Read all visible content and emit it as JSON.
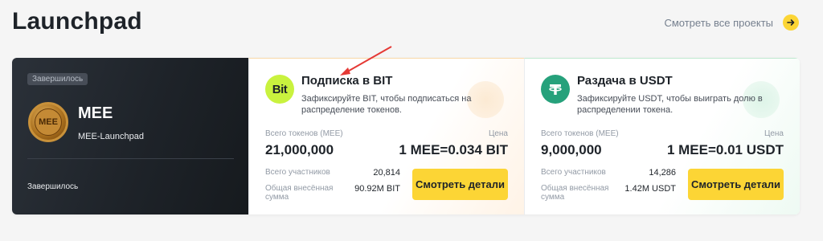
{
  "page": {
    "title": "Launchpad",
    "view_all": "Смотреть все проекты"
  },
  "project": {
    "status_badge": "Завершилось",
    "name": "MEE",
    "subtitle": "MEE-Launchpad",
    "coin_text": "MEE",
    "footer_status": "Завершилось"
  },
  "cards": [
    {
      "logo_text": "Bit",
      "title": "Подписка в BIT",
      "description": "Зафиксируйте BIT, чтобы подписаться на распределение токенов.",
      "tokens_label": "Всего токенов (MEE)",
      "tokens_value": "21,000,000",
      "price_label": "Цена",
      "price_value": "1 MEE=0.034 BIT",
      "participants_label": "Всего участников",
      "participants_value": "20,814",
      "deposit_label": "Общая внесённая сумма",
      "deposit_value": "90.92M BIT",
      "button": "Смотреть детали"
    },
    {
      "logo_text": "T",
      "title": "Раздача в USDT",
      "description": "Зафиксируйте USDT, чтобы выиграть долю в распределении токена.",
      "tokens_label": "Всего токенов (MEE)",
      "tokens_value": "9,000,000",
      "price_label": "Цена",
      "price_value": "1 MEE=0.01 USDT",
      "participants_label": "Всего участников",
      "participants_value": "14,286",
      "deposit_label": "Общая внесённая сумма",
      "deposit_value": "1.42M USDT",
      "button": "Смотреть детали"
    }
  ],
  "colors": {
    "accent": "#fcd535",
    "dark_bg": "#1e2329",
    "bit_logo": "#c9f23e",
    "usdt_logo": "#26a17b",
    "annotation_arrow": "#e53935"
  },
  "icons": [
    "arrow-right-icon",
    "mee-coin-icon",
    "bit-logo-icon",
    "tether-logo-icon",
    "annotation-arrow"
  ]
}
